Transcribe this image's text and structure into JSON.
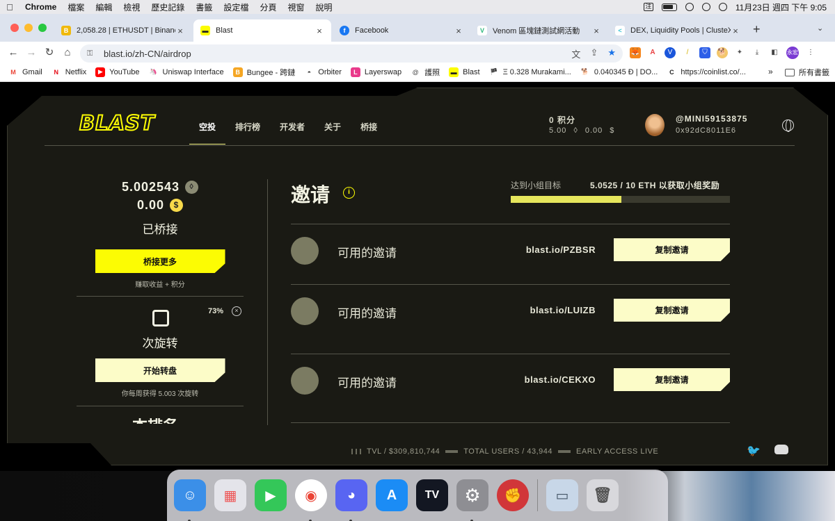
{
  "menubar": {
    "app": "Chrome",
    "items": [
      "檔案",
      "編輯",
      "檢視",
      "歷史記錄",
      "書籤",
      "設定檔",
      "分頁",
      "視窗",
      "說明"
    ],
    "input_method": "注",
    "datetime": "11月23日 週四 下午 9:05"
  },
  "tabs": [
    {
      "title": "2,058.28 | ETHUSDT | Binance",
      "favicon": "B",
      "color": "#f0b90b"
    },
    {
      "title": "Blast",
      "favicon": "▬",
      "color": "#fcfc03",
      "active": true
    },
    {
      "title": "Facebook",
      "favicon": "f",
      "color": "#1877f2"
    },
    {
      "title": "Venom 區塊鏈測試網活動",
      "favicon": "V",
      "color": "#2db87c"
    },
    {
      "title": "DEX, Liquidity Pools | ClusteX",
      "favicon": "<",
      "color": "#3bc5d6"
    }
  ],
  "toolbar": {
    "url": "blast.io/zh-CN/airdrop",
    "profile_initials": "永宏"
  },
  "bookmarks": [
    {
      "label": "Gmail",
      "icon": "M",
      "color": "#ea4335"
    },
    {
      "label": "Netflix",
      "icon": "N",
      "color": "#e50914"
    },
    {
      "label": "YouTube",
      "icon": "▶",
      "color": "#ff0000"
    },
    {
      "label": "Uniswap Interface",
      "icon": "🦄",
      "color": "#ffffff"
    },
    {
      "label": "Bungee - 跨鏈",
      "icon": "B",
      "color": "#f5a623"
    },
    {
      "label": "Orbiter",
      "icon": "◓",
      "color": "#333333"
    },
    {
      "label": "Layerswap",
      "icon": "L",
      "color": "#e93a8b"
    },
    {
      "label": "護照",
      "icon": "@",
      "color": "#555555"
    },
    {
      "label": "Blast",
      "icon": "▬",
      "color": "#fcfc03"
    },
    {
      "label": "Ξ 0.328 Murakami...",
      "icon": "🏴",
      "color": "#ff8a3d"
    },
    {
      "label": "0.040345 Đ | DO...",
      "icon": "🐕",
      "color": "#c2a633"
    },
    {
      "label": "https://coinlist.co/...",
      "icon": "C",
      "color": "#222222"
    }
  ],
  "bookmarks_more": "»",
  "bookmarks_folder": "所有書籤",
  "blast": {
    "logo": "BLAST",
    "nav": [
      {
        "label": "空投",
        "active": true
      },
      {
        "label": "排行榜"
      },
      {
        "label": "开发者"
      },
      {
        "label": "关于"
      },
      {
        "label": "桥接"
      }
    ],
    "points_label": "0 积分",
    "points_eth": "5.00",
    "points_usd": "0.00",
    "username": "@MINI59153875",
    "address": "0x92dC8011E6",
    "left": {
      "eth_balance": "5.002543",
      "usd_balance": "0.00",
      "bridged_label": "已桥接",
      "bridge_more_button": "桥接更多",
      "bridge_caption": "赚取收益 + 积分",
      "spin_percent": "73%",
      "spin_count": "0",
      "spin_label": "次旋转",
      "spin_button": "开始转盘",
      "spin_caption": "你每周获得 5.003 次旋转",
      "next_section_title": "本排名"
    },
    "invite": {
      "title": "邀请",
      "goal_label": "达到小组目标",
      "goal_value": "5.0525 / 10 ETH 以获取小组奖励",
      "goal_progress": 0.505,
      "rows": [
        {
          "label": "可用的邀请",
          "link": "blast.io/PZBSR",
          "button": "复制邀请"
        },
        {
          "label": "可用的邀请",
          "link": "blast.io/LUIZB",
          "button": "复制邀请"
        },
        {
          "label": "可用的邀请",
          "link": "blast.io/CEKXO",
          "button": "复制邀请"
        }
      ]
    },
    "footer": {
      "tvl": "TVL / $309,810,744",
      "users": "TOTAL USERS / 43,944",
      "access": "EARLY ACCESS LIVE"
    }
  },
  "dock": [
    {
      "name": "Finder",
      "icon": "☺",
      "color": "#3b8fe8"
    },
    {
      "name": "Launchpad",
      "icon": "▦",
      "color": "#d9d9de"
    },
    {
      "name": "FaceTime",
      "icon": "▶",
      "color": "#34c759"
    },
    {
      "name": "Chrome",
      "icon": "◉",
      "color": "#ea4335"
    },
    {
      "name": "Discord",
      "icon": "◕",
      "color": "#5865f2"
    },
    {
      "name": "App Store",
      "icon": "A",
      "color": "#1b8cf5"
    },
    {
      "name": "TradingView",
      "icon": "TV",
      "color": "#131722"
    },
    {
      "name": "System Settings",
      "icon": "⚙",
      "color": "#8e8e93"
    },
    {
      "name": "Riot",
      "icon": "✊",
      "color": "#d13639"
    },
    {
      "name": "Preview",
      "icon": "▭",
      "color": "#c8d7e8"
    },
    {
      "name": "Trash",
      "icon": "🗑",
      "color": "#c8c8cc"
    }
  ],
  "colors": {
    "accent_yellow": "#fcfc03",
    "button_cream": "#fcfcc8",
    "panel_bg": "#1a1a14"
  }
}
